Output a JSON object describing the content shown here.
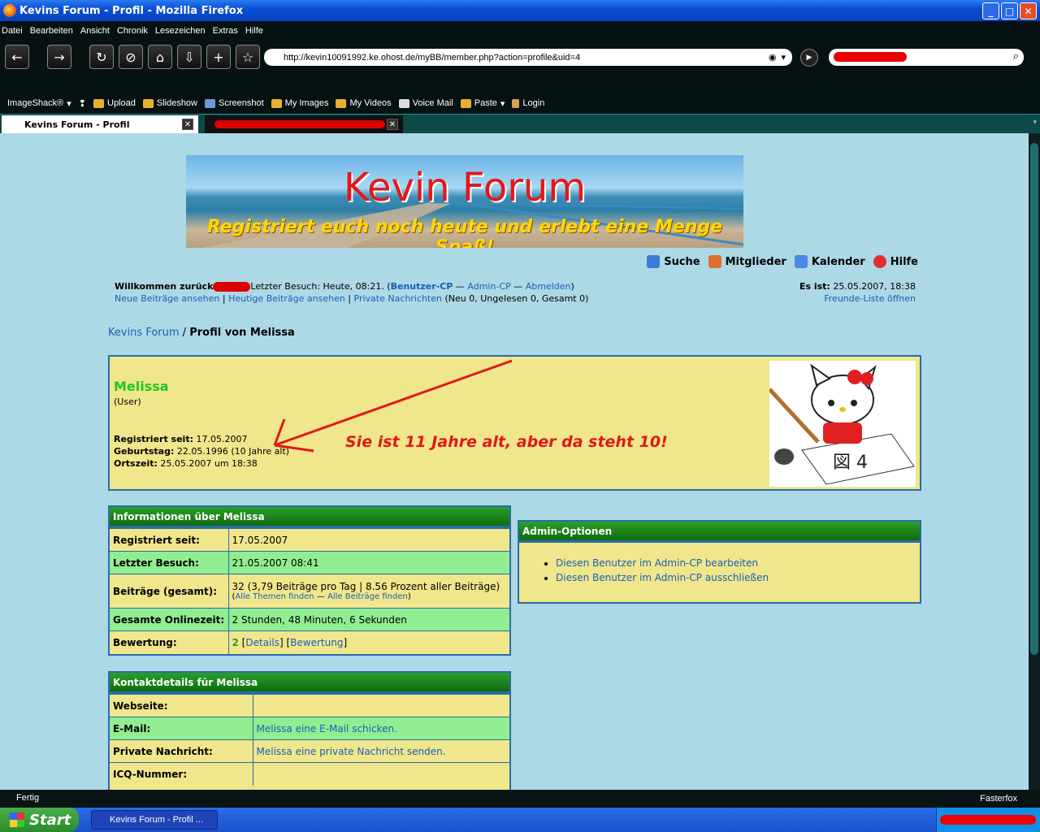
{
  "window": {
    "title": "Kevins Forum - Profil - Mozilla Firefox",
    "controls": [
      "_",
      "□",
      "✕"
    ]
  },
  "menu": [
    "Datei",
    "Bearbeiten",
    "Ansicht",
    "Chronik",
    "Lesezeichen",
    "Extras",
    "Hilfe"
  ],
  "address": {
    "url": "http://kevin10091992.ke.ohost.de/myBB/member.php?action=profile&uid=4"
  },
  "bookmarks_toolbar": [
    {
      "label": "ImageShack®",
      "icon": "imageshack-icon"
    },
    {
      "label": "Upload",
      "icon": "upload-icon"
    },
    {
      "label": "Slideshow",
      "icon": "slideshow-icon"
    },
    {
      "label": "Screenshot",
      "icon": "screenshot-icon"
    },
    {
      "label": "My Images",
      "icon": "folder-icon"
    },
    {
      "label": "My Videos",
      "icon": "folder-icon"
    },
    {
      "label": "Voice Mail",
      "icon": "voicemail-icon"
    },
    {
      "label": "Paste",
      "icon": "paste-icon"
    },
    {
      "label": "Login",
      "icon": "user-icon"
    }
  ],
  "tabs": [
    {
      "label": "Kevins Forum - Profil",
      "active": true
    },
    {
      "label": "",
      "active": false
    }
  ],
  "forum": {
    "banner_title": "Kevin Forum",
    "banner_subtitle": "Registriert euch noch heute und erlebt eine Menge Spaß!",
    "quicknav": [
      {
        "label": "Suche",
        "icon": "search-icon",
        "color": "#3a7ad8"
      },
      {
        "label": "Mitglieder",
        "icon": "members-icon",
        "color": "#e07030"
      },
      {
        "label": "Kalender",
        "icon": "calendar-icon",
        "color": "#4a8ae8"
      },
      {
        "label": "Hilfe",
        "icon": "help-icon",
        "color": "#e03030"
      }
    ],
    "welcome": {
      "prefix": "Willkommen zurück",
      "last_visit": "Letzter Besuch: Heute, 08:21. (",
      "usercp": "Benutzer-CP",
      "sep1": " — ",
      "admincp": "Admin-CP",
      "sep2": " — ",
      "logout": "Abmelden",
      "close": ")",
      "new_posts": "Neue Beiträge ansehen",
      "pipe": " | ",
      "today_posts": "Heutige Beiträge ansehen",
      "pms": "Private Nachrichten",
      "pm_counts": " (Neu 0, Ungelesen 0, Gesamt 0)",
      "now_label": "Es ist:",
      "now_value": " 25.05.2007, 18:38",
      "buddy": "Freunde-Liste öffnen"
    },
    "breadcrumb": {
      "root": "Kevins Forum",
      "sep": " / ",
      "current": "Profil von Melissa"
    },
    "profile": {
      "name": "Melissa",
      "role": "(User)",
      "registered_label": "Registriert seit:",
      "registered_value": " 17.05.2007",
      "birthday_label": "Geburtstag:",
      "birthday_value": " 22.05.1996 (10 Jahre alt)",
      "localtime_label": "Ortszeit:",
      "localtime_value": " 25.05.2007 um 18:38",
      "annotation": "Sie ist 11 Jahre alt, aber da steht 10!"
    },
    "info_panel": {
      "title": "Informationen über Melissa",
      "rows": [
        {
          "k": "Registriert seit:",
          "v": "17.05.2007"
        },
        {
          "k": "Letzter Besuch:",
          "v": "21.05.2007 08:41"
        },
        {
          "k": "Beiträge (gesamt):",
          "v": "32 (3,79 Beiträge pro Tag | 8.56 Prozent aller Beiträge)"
        },
        {
          "k": "Gesamte Onlinezeit:",
          "v": "2 Stunden, 48 Minuten, 6 Sekunden"
        },
        {
          "k": "Bewertung:",
          "v": ""
        }
      ],
      "posts_links": {
        "open": "(",
        "threads": "Alle Themen finden",
        "sep": " — ",
        "posts": "Alle Beiträge finden",
        "close": ")"
      },
      "rating": {
        "value": "2",
        "b1": " [",
        "details": "Details",
        "b2": "] [",
        "rate": "Bewertung",
        "b3": "]"
      }
    },
    "contact_panel": {
      "title": "Kontaktdetails für Melissa",
      "rows": [
        {
          "k": "Webseite:",
          "v": ""
        },
        {
          "k": "E-Mail:",
          "v": "Melissa eine E-Mail schicken."
        },
        {
          "k": "Private Nachricht:",
          "v": "Melissa eine private Nachricht senden."
        },
        {
          "k": "ICQ-Nummer:",
          "v": ""
        }
      ]
    },
    "admin_panel": {
      "title": "Admin-Optionen",
      "items": [
        "Diesen Benutzer im Admin-CP bearbeiten",
        "Diesen Benutzer im Admin-CP ausschließen"
      ]
    }
  },
  "status": {
    "left": "Fertig",
    "right": "Fasterfox"
  },
  "taskbar": {
    "start": "Start",
    "item": "Kevins Forum - Profil ..."
  }
}
